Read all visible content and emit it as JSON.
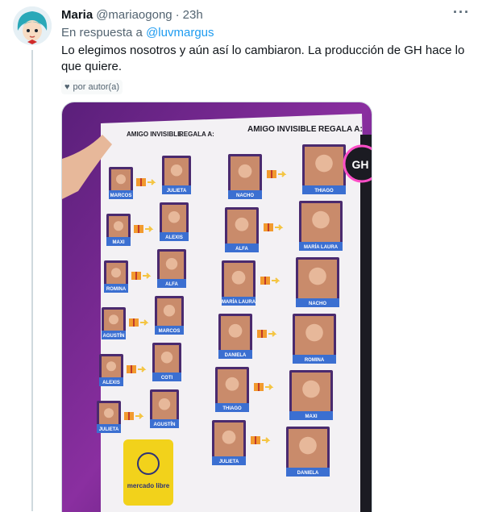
{
  "tweet": {
    "name": "Maria",
    "handle": "@mariaogong",
    "dot": "·",
    "time": "23h",
    "more_icon": "more-horizontal-icon",
    "reply_prefix": "En respuesta a",
    "reply_to": "@luvmargus",
    "text": "Lo elegimos nosotros y aún así lo cambiaron. La producción de GH hace lo que quiere.",
    "liked_by_author": "por autor(a)",
    "heart_icon": "heart-icon"
  },
  "media": {
    "colors": {
      "board_header": "#4a2a6e",
      "card_blue": "#3b6fd1",
      "gift": "#f29a2e",
      "sponsor": "#f2d21b"
    },
    "headers": [
      "AMIGO INVISIBLE",
      "REGALA A:",
      "AMIGO INVISIBLE",
      "REGALA A:"
    ],
    "sponsor": "mercado libre",
    "left_givers": [
      "MARCOS",
      "MAXI",
      "ROMINA",
      "AGUSTÍN",
      "ALEXIS",
      "JULIETA"
    ],
    "left_receivers": [
      "JULIETA",
      "ALEXIS",
      "ALFA",
      "MARCOS",
      "COTI",
      "AGUSTÍN"
    ],
    "right_givers": [
      "NACHO",
      "ALFA",
      "MARÍA LAURA",
      "DANIELA",
      "THIAGO",
      "JULIETA"
    ],
    "right_receivers": [
      "THIAGO",
      "MARÍA LAURA",
      "NACHO",
      "ROMINA",
      "MAXI",
      "DANIELA"
    ],
    "logo_letter": "GH"
  }
}
